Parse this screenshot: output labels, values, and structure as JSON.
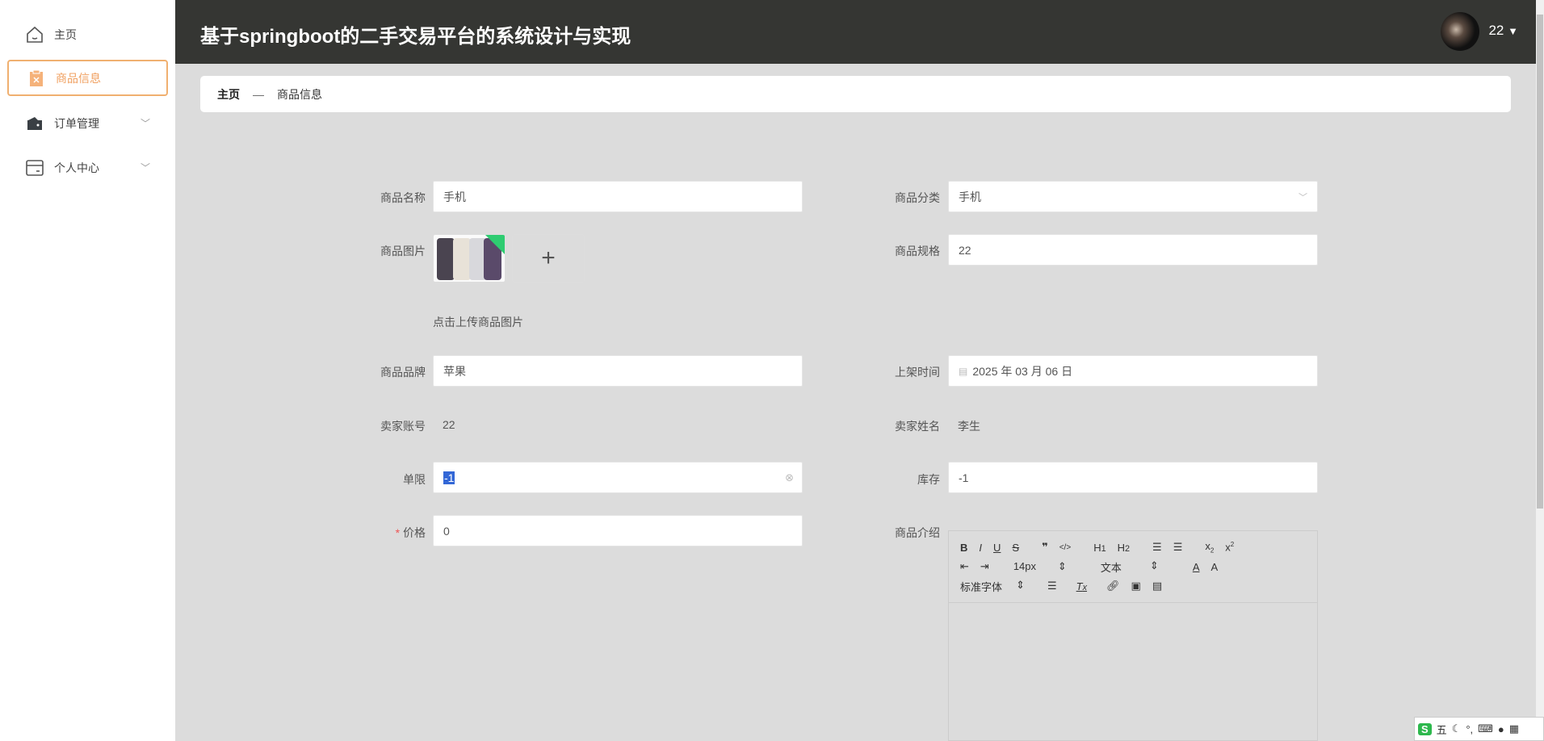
{
  "sidebar": {
    "items": [
      {
        "label": "主页"
      },
      {
        "label": "商品信息"
      },
      {
        "label": "订单管理"
      },
      {
        "label": "个人中心"
      }
    ]
  },
  "header": {
    "title": "基于springboot的二手交易平台的系统设计与实现",
    "user": "22"
  },
  "breadcrumb": {
    "home": "主页",
    "sep": "—",
    "current": "商品信息"
  },
  "form": {
    "name_label": "商品名称",
    "name_value": "手机",
    "category_label": "商品分类",
    "category_value": "手机",
    "image_label": "商品图片",
    "image_hint": "点击上传商品图片",
    "spec_label": "商品规格",
    "spec_value": "22",
    "brand_label": "商品品牌",
    "brand_value": "苹果",
    "date_label": "上架时间",
    "date_value": "2025 年 03 月 06 日",
    "seller_account_label": "卖家账号",
    "seller_account_value": "22",
    "seller_name_label": "卖家姓名",
    "seller_name_value": "李生",
    "limit_label": "单限",
    "limit_value": "-1",
    "stock_label": "库存",
    "stock_value": "-1",
    "price_required": "*",
    "price_label": "价格",
    "price_value": "0",
    "intro_label": "商品介绍"
  },
  "editor": {
    "font_size": "14px",
    "block": "文本",
    "font": "标准字体"
  },
  "ime": {
    "label": "五"
  },
  "colors": {
    "accent": "#f0a060",
    "header": "#353633"
  }
}
